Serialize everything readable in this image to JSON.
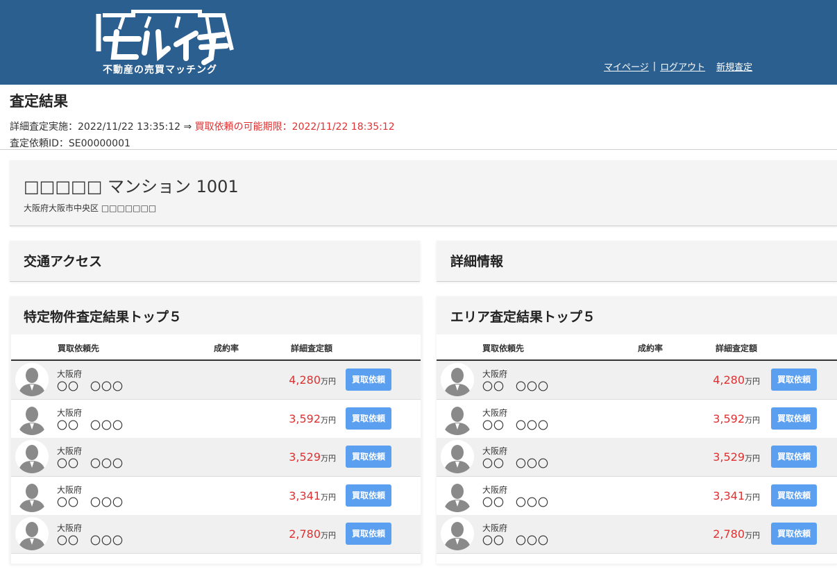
{
  "header": {
    "logo_main": "セルイチ",
    "logo_sub": "不動産の売買マッチング",
    "nav": {
      "mypage": "マイページ",
      "separator": "|",
      "logout": "ログアウト",
      "new_assessment": "新規査定"
    }
  },
  "page": {
    "title": "査定結果",
    "assessment_label": "詳細査定実施：2022/11/22 13:35:12 ⇒ ",
    "deadline_label": "買取依頼の可能期限：2022/11/22 18:35:12",
    "request_id": "査定依頼ID：SE00000001"
  },
  "property": {
    "name": "□□□□□ マンション 1001",
    "address": "大阪府大阪市中央区 □□□□□□□"
  },
  "sections": {
    "access": "交通アクセス",
    "details": "詳細情報",
    "specific_top5": "特定物件査定結果トップ５",
    "area_top5": "エリア査定結果トップ５"
  },
  "table_headers": {
    "buyer": "買取依頼先",
    "rate": "成約率",
    "amount": "詳細査定額"
  },
  "specific_rows": [
    {
      "pref": "大阪府",
      "name": "〇〇　〇〇〇",
      "amount": "4,280",
      "unit": "万円",
      "button": "買取依頼"
    },
    {
      "pref": "大阪府",
      "name": "〇〇　〇〇〇",
      "amount": "3,592",
      "unit": "万円",
      "button": "買取依頼"
    },
    {
      "pref": "大阪府",
      "name": "〇〇　〇〇〇",
      "amount": "3,529",
      "unit": "万円",
      "button": "買取依頼"
    },
    {
      "pref": "大阪府",
      "name": "〇〇　〇〇〇",
      "amount": "3,341",
      "unit": "万円",
      "button": "買取依頼"
    },
    {
      "pref": "大阪府",
      "name": "〇〇　〇〇〇",
      "amount": "2,780",
      "unit": "万円",
      "button": "買取依頼"
    }
  ],
  "area_rows": [
    {
      "pref": "大阪府",
      "name": "〇〇　〇〇〇",
      "amount": "4,280",
      "unit": "万円",
      "button": "買取依頼"
    },
    {
      "pref": "大阪府",
      "name": "〇〇　〇〇〇",
      "amount": "3,592",
      "unit": "万円",
      "button": "買取依頼"
    },
    {
      "pref": "大阪府",
      "name": "〇〇　〇〇〇",
      "amount": "3,529",
      "unit": "万円",
      "button": "買取依頼"
    },
    {
      "pref": "大阪府",
      "name": "〇〇　〇〇〇",
      "amount": "3,341",
      "unit": "万円",
      "button": "買取依頼"
    },
    {
      "pref": "大阪府",
      "name": "〇〇　〇〇〇",
      "amount": "2,780",
      "unit": "万円",
      "button": "買取依頼"
    }
  ],
  "colors": {
    "header_bg": "#2a5f8f",
    "accent_red": "#e03030",
    "button_blue": "#5b9ff0"
  },
  "icons": {
    "avatar": "person-silhouette-icon"
  }
}
